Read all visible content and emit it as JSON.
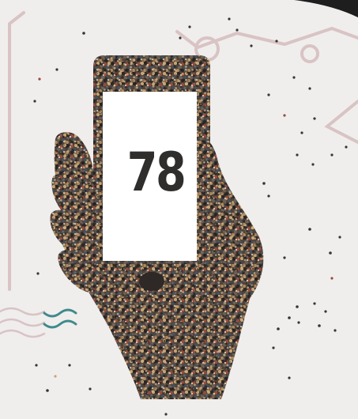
{
  "page_number": "78",
  "illustration": {
    "subject": "crowd-of-people-forming-hand-holding-smartphone-icon",
    "icons": [
      "hand-icon",
      "smartphone-icon",
      "circle-icon",
      "wave-icon",
      "triangle-icon"
    ]
  },
  "colors": {
    "background": "#efeeec",
    "phone_screen": "#ffffff",
    "crowd": [
      "#3a3430",
      "#5a4a3e",
      "#8a6e52",
      "#b08a5e",
      "#6d5f55",
      "#9a4a3a",
      "#c9a574",
      "#48515c",
      "#7a7068",
      "#2b2623"
    ],
    "outline_decor": "#d9c3c4",
    "wave_decor": "#3e8a8c",
    "corner_dark": "#1e1e1e",
    "number": "#2f2e2c"
  }
}
